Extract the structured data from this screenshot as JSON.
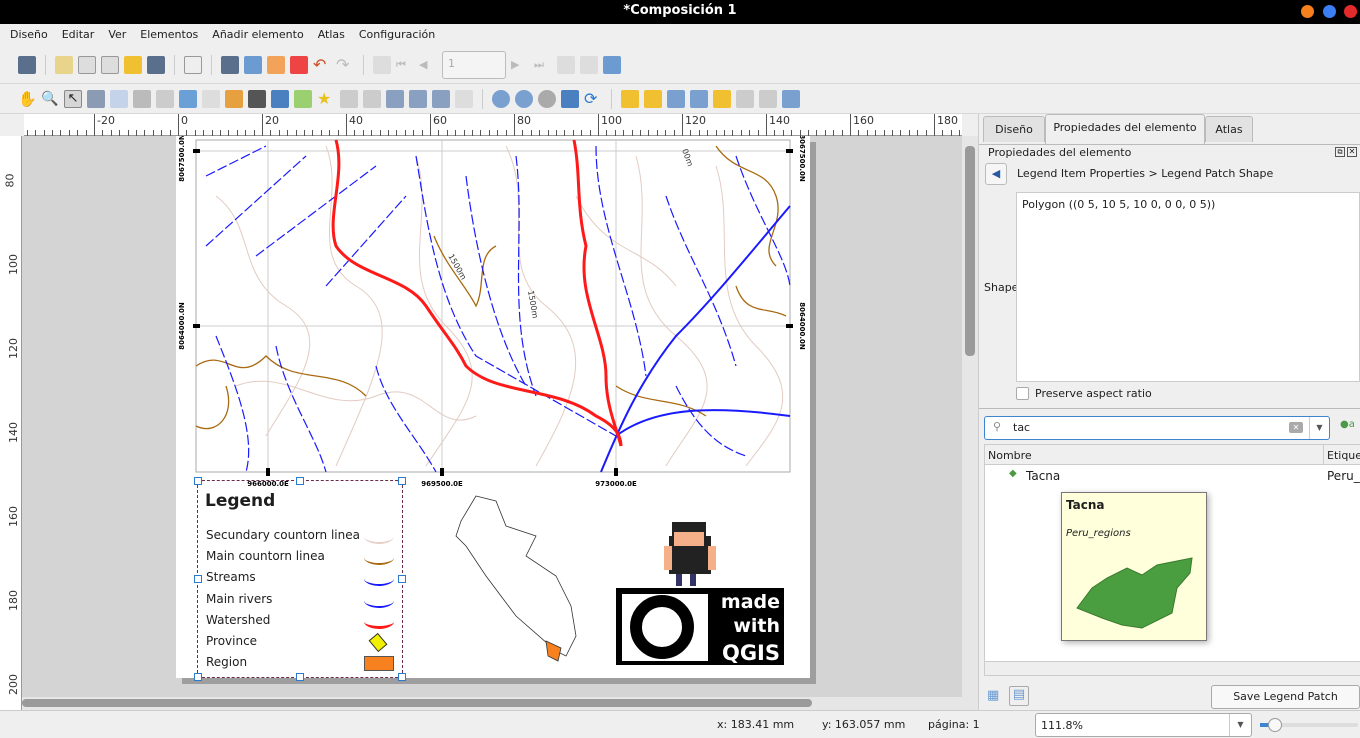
{
  "window": {
    "title": "*Composición 1"
  },
  "menu": [
    "Diseño",
    "Editar",
    "Ver",
    "Elementos",
    "Añadir elemento",
    "Atlas",
    "Configuración"
  ],
  "toolbar": {
    "page_value": "1"
  },
  "ruler": {
    "top_ticks": [
      "-20",
      "0",
      "20",
      "40",
      "60",
      "80",
      "100",
      "120",
      "140",
      "160",
      "180"
    ],
    "left_ticks": [
      "80",
      "100",
      "120",
      "140",
      "160",
      "180",
      "200"
    ]
  },
  "map": {
    "grid_x": [
      "966000.0E",
      "969500.0E",
      "973000.0E"
    ],
    "grid_y": [
      "8067500.0N",
      "8064000.0N"
    ],
    "contour_labels": [
      "1500m",
      "1500m",
      "00m"
    ]
  },
  "legend": {
    "title": "Legend",
    "items": [
      {
        "label": "Secundary countorn linea",
        "color": "#e8cfc8"
      },
      {
        "label": "Main countorn linea",
        "color": "#a86a10"
      },
      {
        "label": "Streams",
        "color": "#1a1aff"
      },
      {
        "label": "Main rivers",
        "color": "#1a1aff"
      },
      {
        "label": "Watershed",
        "color": "#ff1a1a"
      },
      {
        "label": "Province",
        "color": "#f0f000"
      },
      {
        "label": "Region",
        "color": "#f7811e"
      }
    ]
  },
  "logo": {
    "text": "made with QGIS"
  },
  "panel": {
    "tabs": [
      "Diseño",
      "Propiedades del elemento",
      "Atlas"
    ],
    "active_tab": 1,
    "header": "Propiedades del elemento",
    "breadcrumb": "Legend Item Properties > Legend Patch Shape",
    "shape_label": "Shape",
    "shape_value": "Polygon ((0 5, 10 5, 10 0, 0 0, 0 5))",
    "preserve_aspect": "Preserve aspect ratio",
    "preserve_checked": false,
    "search_value": "tac",
    "col_name": "Nombre",
    "col_label": "Etique",
    "row": {
      "name": "Tacna",
      "label": "Peru_"
    },
    "tooltip": {
      "title": "Tacna",
      "subtitle": "Peru_regions"
    },
    "save_button": "Save Legend Patch Shape..."
  },
  "status": {
    "x": "x: 183.41 mm",
    "y": "y: 163.057 mm",
    "page": "página: 1",
    "zoom": "111.8%",
    "zoom_slider": 0.1
  }
}
